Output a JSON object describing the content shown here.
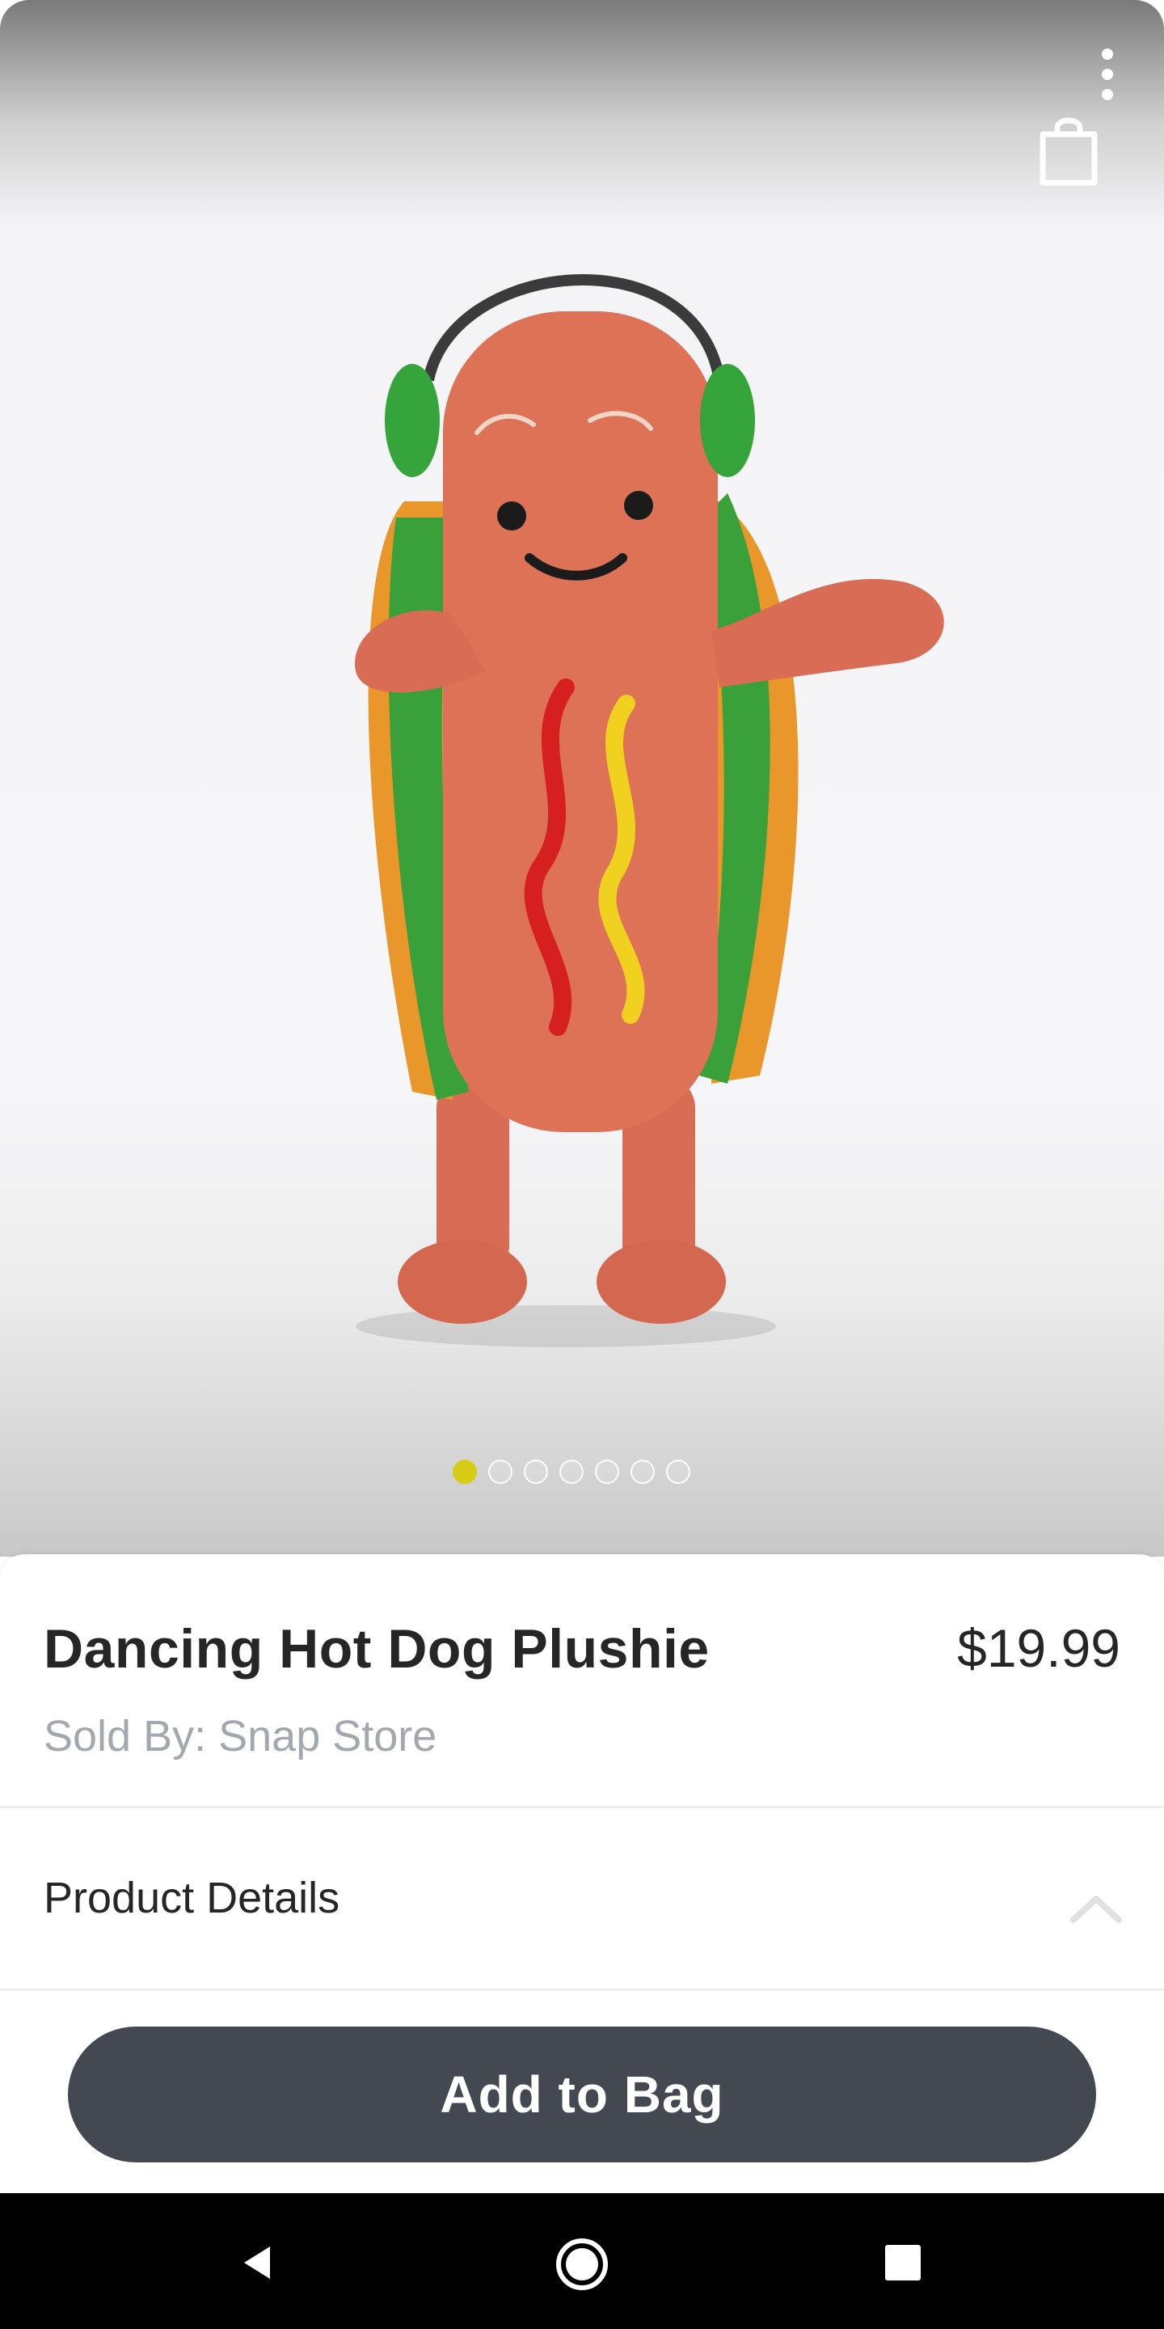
{
  "product": {
    "title": "Dancing Hot Dog Plushie",
    "price": "$19.99",
    "seller": "Sold By: Snap Store"
  },
  "gallery": {
    "image_subject": "hot-dog-plushie",
    "total_images": 7,
    "active_index": 0,
    "indicator_active_color": "#d7cc16"
  },
  "icons": {
    "menu": "more-vertical-icon",
    "bag": "shopping-bag-icon",
    "expand": "chevron-up-icon"
  },
  "sections": {
    "details_label": "Product Details"
  },
  "actions": {
    "add_to_bag": "Add to Bag",
    "button_color": "#434851"
  },
  "system_nav": {
    "back": "back-icon",
    "home": "home-icon",
    "recents": "recents-icon"
  }
}
